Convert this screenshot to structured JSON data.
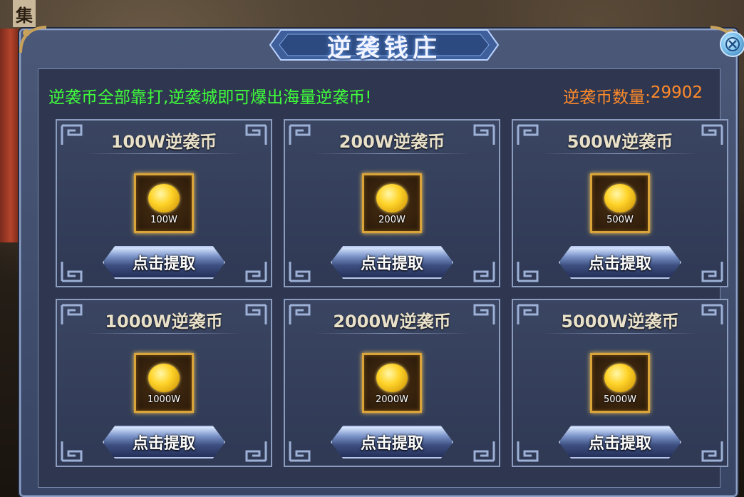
{
  "background": {
    "sign_char": "集"
  },
  "dialog": {
    "title": "逆袭钱庄",
    "close_icon": "close-icon",
    "notice": "逆袭币全部靠打,逆袭城即可爆出海量逆袭币!",
    "coin_count_label": "逆袭币数量:",
    "coin_count_value": "29902"
  },
  "items": [
    {
      "title": "100W逆袭币",
      "coin_label": "100W",
      "button": "点击提取",
      "icon": "gold-coin-icon"
    },
    {
      "title": "200W逆袭币",
      "coin_label": "200W",
      "button": "点击提取",
      "icon": "gold-coin-icon"
    },
    {
      "title": "500W逆袭币",
      "coin_label": "500W",
      "button": "点击提取",
      "icon": "gold-coin-icon"
    },
    {
      "title": "1000W逆袭币",
      "coin_label": "1000W",
      "button": "点击提取",
      "icon": "gold-coin-icon"
    },
    {
      "title": "2000W逆袭币",
      "coin_label": "2000W",
      "button": "点击提取",
      "icon": "gold-coin-icon"
    },
    {
      "title": "5000W逆袭币",
      "coin_label": "5000W",
      "button": "点击提取",
      "icon": "gold-coin-icon"
    }
  ],
  "colors": {
    "notice": "#3fff3a",
    "coin_count": "#ff8a2a",
    "frame_gold": "#d9a43a",
    "panel_blue": "#394565"
  }
}
